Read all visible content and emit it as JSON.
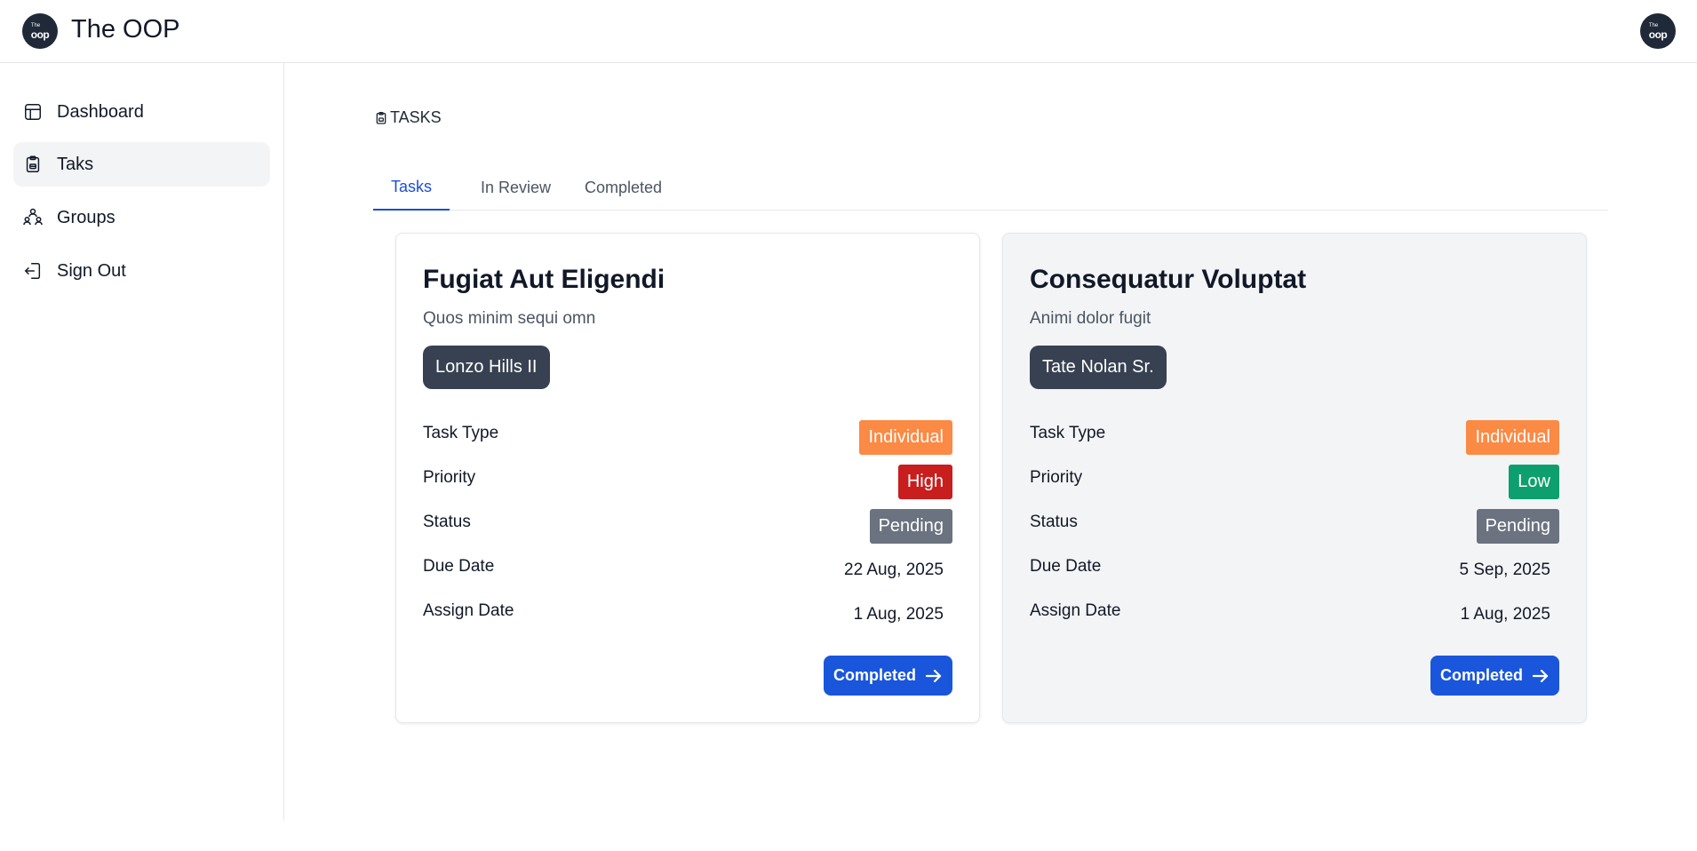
{
  "header": {
    "logo_small": "The",
    "logo_big": "oop",
    "title": "The OOP",
    "avatar_small": "The",
    "avatar_big": "oop"
  },
  "sidebar": {
    "items": [
      {
        "label": "Dashboard",
        "icon": "layout-icon"
      },
      {
        "label": "Taks",
        "icon": "clipboard-icon",
        "active": true
      },
      {
        "label": "Groups",
        "icon": "users-icon"
      },
      {
        "label": "Sign Out",
        "icon": "sign-out-icon"
      }
    ]
  },
  "main": {
    "section_label": "TASKS",
    "tabs": [
      {
        "label": "Tasks",
        "active": true
      },
      {
        "label": "In Review"
      },
      {
        "label": "Completed"
      }
    ],
    "cards": [
      {
        "title": "Fugiat Aut Eligendi",
        "description": "Quos minim sequi omn",
        "assignee": "Lonzo Hills II",
        "task_type_label": "Task Type",
        "task_type": "Individual",
        "priority_label": "Priority",
        "priority": "High",
        "status_label": "Status",
        "status": "Pending",
        "due_date_label": "Due Date",
        "due_date": "22 Aug, 2025",
        "assign_date_label": "Assign Date",
        "assign_date": "1 Aug, 2025",
        "button_label": "Completed"
      },
      {
        "title": "Consequatur Voluptat",
        "description": "Animi dolor fugit",
        "assignee": "Tate Nolan Sr.",
        "task_type_label": "Task Type",
        "task_type": "Individual",
        "priority_label": "Priority",
        "priority": "Low",
        "status_label": "Status",
        "status": "Pending",
        "due_date_label": "Due Date",
        "due_date": "5 Sep, 2025",
        "assign_date_label": "Assign Date",
        "assign_date": "1 Aug, 2025",
        "button_label": "Completed"
      }
    ]
  },
  "colors": {
    "primary": "#1a56db",
    "orange": "#fb8a45",
    "red": "#c81e1e",
    "green": "#0e9f6e",
    "gray": "#6b7280",
    "dark": "#374151"
  }
}
